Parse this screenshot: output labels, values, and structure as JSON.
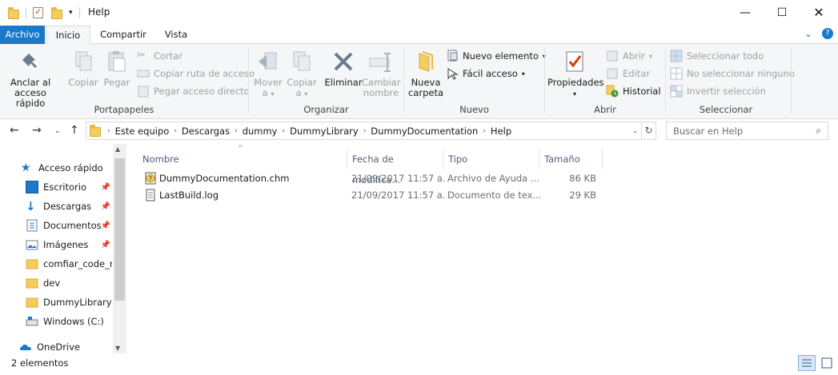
{
  "window": {
    "title": "Help"
  },
  "tabs": {
    "archivo": "Archivo",
    "inicio": "Inicio",
    "compartir": "Compartir",
    "vista": "Vista"
  },
  "ribbon": {
    "portapapeles": {
      "label": "Portapapeles",
      "anclar": "Anclar al acceso rápido",
      "copiar": "Copiar",
      "pegar": "Pegar",
      "cortar": "Cortar",
      "copiar_ruta": "Copiar ruta de acceso",
      "pegar_acceso": "Pegar acceso directo"
    },
    "organizar": {
      "label": "Organizar",
      "mover": "Mover a",
      "copiar_a": "Copiar a",
      "eliminar": "Eliminar",
      "cambiar": "Cambiar nombre"
    },
    "nuevo": {
      "label": "Nuevo",
      "nueva_carpeta": "Nueva carpeta",
      "nuevo_elemento": "Nuevo elemento",
      "facil_acceso": "Fácil acceso"
    },
    "abrir": {
      "label": "Abrir",
      "propiedades": "Propiedades",
      "abrir": "Abrir",
      "editar": "Editar",
      "historial": "Historial"
    },
    "seleccionar": {
      "label": "Seleccionar",
      "todo": "Seleccionar todo",
      "ninguno": "No seleccionar ninguno",
      "invertir": "Invertir selección"
    }
  },
  "address": {
    "crumbs": [
      "Este equipo",
      "Descargas",
      "dummy",
      "DummyLibrary",
      "DummyDocumentation",
      "Help"
    ],
    "search_placeholder": "Buscar en Help"
  },
  "navpane": {
    "items": [
      {
        "label": "Acceso rápido",
        "pinned": false
      },
      {
        "label": "Escritorio",
        "pinned": true
      },
      {
        "label": "Descargas",
        "pinned": true
      },
      {
        "label": "Documentos",
        "pinned": true
      },
      {
        "label": "Imágenes",
        "pinned": true
      },
      {
        "label": "comfiar_code_re",
        "pinned": false
      },
      {
        "label": "dev",
        "pinned": false
      },
      {
        "label": "DummyLibrary",
        "pinned": false
      },
      {
        "label": "Windows (C:)",
        "pinned": false
      },
      {
        "label": "OneDrive",
        "pinned": false
      }
    ]
  },
  "filelist": {
    "columns": [
      "Nombre",
      "Fecha de modifica...",
      "Tipo",
      "Tamaño"
    ],
    "rows": [
      {
        "name": "DummyDocumentation.chm",
        "date": "21/09/2017 11:57 a...",
        "type": "Archivo de Ayuda ...",
        "size": "86 KB"
      },
      {
        "name": "LastBuild.log",
        "date": "21/09/2017 11:57 a...",
        "type": "Documento de tex...",
        "size": "29 KB"
      }
    ]
  },
  "status": {
    "count": "2 elementos"
  },
  "colors": {
    "accent": "#1979ca",
    "folder": "#f5cd5a",
    "ribbon_bg": "#f5f6f7"
  }
}
